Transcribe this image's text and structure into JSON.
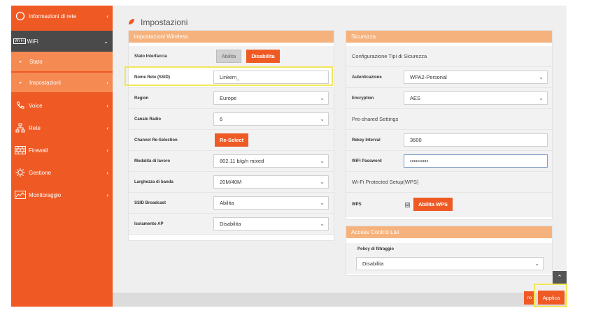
{
  "sidebar": {
    "items": [
      {
        "label": "Informazioni di rete",
        "icon": "circle-icon"
      },
      {
        "label": "WiFi",
        "icon": "wifi-icon"
      },
      {
        "label": "Stato"
      },
      {
        "label": "Impostazioni"
      },
      {
        "label": "Voice",
        "icon": "phone-icon"
      },
      {
        "label": "Rete",
        "icon": "network-icon"
      },
      {
        "label": "Firewall",
        "icon": "firewall-icon"
      },
      {
        "label": "Gestione",
        "icon": "gear-icon"
      },
      {
        "label": "Monitoraggio",
        "icon": "chart-icon"
      }
    ],
    "wifi_icon_text": "Wi Fi",
    "wifi_caret": "⌄",
    "chevron": "‹"
  },
  "page": {
    "title": "Impostazioni"
  },
  "wireless": {
    "title": "Impostazioni Wireless",
    "stato_interfaccia": {
      "label": "Stato Interfaccia",
      "enable_btn": "Abilita",
      "disable_btn": "Disabilita"
    },
    "ssid": {
      "label": "Nome Rete (SSID)",
      "value": "Linkem_"
    },
    "region": {
      "label": "Region",
      "value": "Europe"
    },
    "canale_radio": {
      "label": "Canale Radio",
      "value": "6"
    },
    "channel_reselection": {
      "label": "Channel Re-Selection",
      "button": "Re-Select"
    },
    "modalita": {
      "label": "Modalità di lavoro",
      "value": "802.11 b/g/n mixed"
    },
    "larghezza": {
      "label": "Larghezza di banda",
      "value": "20M/40M"
    },
    "ssid_broadcast": {
      "label": "SSID Broadcast",
      "value": "Abilita"
    },
    "isolamento": {
      "label": "Isolamento AP",
      "value": "Disabilita"
    }
  },
  "security": {
    "title": "Sicurezza",
    "config_heading": "Configurazione Tipi di Sicurezza",
    "autenticazione": {
      "label": "Autenticazione",
      "value": "WPA2-Personal"
    },
    "encryption": {
      "label": "Encryption",
      "value": "AES"
    },
    "preshared_heading": "Pre-shared Settings",
    "rekey": {
      "label": "Rekey Interval",
      "value": "3600"
    },
    "password": {
      "label": "WiFi Password",
      "value": "••••••••••"
    },
    "wps_heading": "Wi-Fi Protected Setup(WPS)",
    "wps": {
      "label": "WPS",
      "button": "Abilita WPS",
      "check": "☑"
    }
  },
  "acl": {
    "title": "Access Control List",
    "policy": {
      "label": "Policy di filtraggio",
      "value": "Disabilita"
    }
  },
  "footer": {
    "reset_label": "no",
    "apply_label": "Applica",
    "scroll_top": "⌃"
  },
  "colors": {
    "accent": "#ef5a24",
    "panel_header": "#f6b27c",
    "highlight": "#f3e65a"
  }
}
